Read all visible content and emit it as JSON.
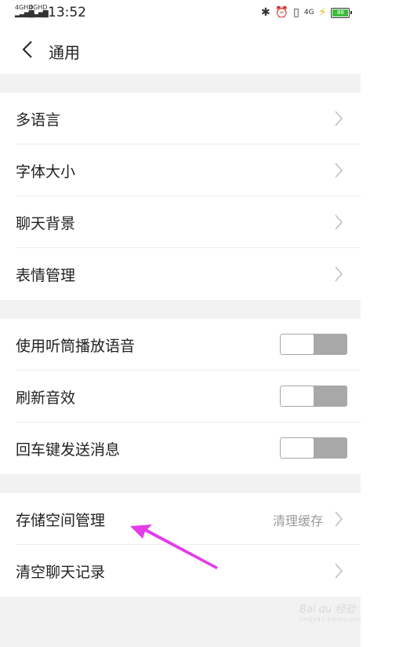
{
  "status_bar": {
    "signal1": "4GHD",
    "signal2": "4GHD",
    "time": "13:52",
    "icons": [
      "bluetooth-icon",
      "alarm-icon",
      "vibrate-icon",
      "4g-icon",
      "charging-icon",
      "battery-icon"
    ],
    "network": "4G",
    "battery_level": "88"
  },
  "header": {
    "title": "通用"
  },
  "groups": {
    "g1": [
      {
        "label": "多语言"
      },
      {
        "label": "字体大小"
      },
      {
        "label": "聊天背景"
      },
      {
        "label": "表情管理"
      }
    ],
    "g2": [
      {
        "label": "使用听筒播放语音",
        "on": false
      },
      {
        "label": "刷新音效",
        "on": false
      },
      {
        "label": "回车键发送消息",
        "on": false
      }
    ],
    "g3": [
      {
        "label": "存储空间管理",
        "sub": "清理缓存"
      },
      {
        "label": "清空聊天记录"
      }
    ]
  },
  "annotation": {
    "arrow_color": "#e33de8"
  },
  "watermark": {
    "main": "Bai du 经验",
    "sub": "jingyan.baidu.com"
  },
  "colors": {
    "gap_bg": "#f2f2f2",
    "toggle_off": "#a8a8a8",
    "chevron": "#bdbdbd"
  }
}
